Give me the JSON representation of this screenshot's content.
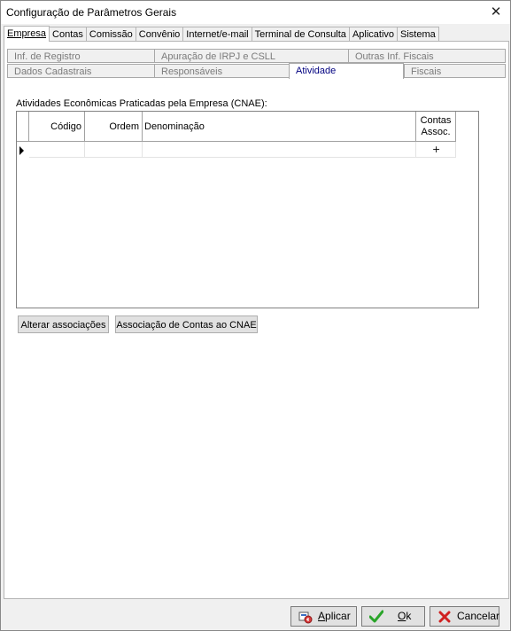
{
  "window": {
    "title": "Configuração de Parâmetros Gerais"
  },
  "top_tabs": [
    "Empresa",
    "Contas",
    "Comissão",
    "Convênio",
    "Internet/e-mail",
    "Terminal de Consulta",
    "Aplicativo",
    "Sistema"
  ],
  "sub_tabs_row1": [
    "Inf. de Registro",
    "Apuração de IRPJ e CSLL",
    "Outras Inf. Fiscais"
  ],
  "sub_tabs_row2": [
    "Dados Cadastrais",
    "Responsáveis",
    "Atividade",
    "Fiscais"
  ],
  "section": {
    "label": "Atividades Econômicas Praticadas pela Empresa (CNAE):"
  },
  "grid": {
    "columns": {
      "codigo": "Código",
      "ordem": "Ordem",
      "denominacao": "Denominação",
      "contas_1": "Contas",
      "contas_2": "Assoc."
    },
    "plus": "+"
  },
  "buttons": {
    "alterar": "Alterar associações",
    "associacao": "Associação de Contas ao CNAE"
  },
  "footer": {
    "aplicar_prefix": "A",
    "aplicar_rest": "plicar",
    "ok_prefix": "O",
    "ok_rest": "k",
    "cancelar": "Cancelar"
  },
  "colors": {
    "active_tab_text": "#000080",
    "ok_green": "#2aa52a",
    "cancel_red": "#d02020"
  }
}
